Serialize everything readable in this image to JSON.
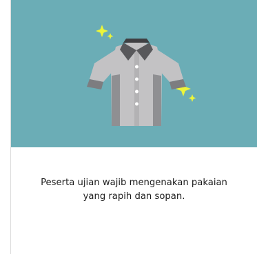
{
  "illustration": {
    "icon": "shirt-icon",
    "sparkles": [
      "sparkle-icon",
      "sparkle-icon"
    ],
    "background_color": "#6badb6",
    "shirt_color": "#c3c2c4",
    "collar_color": "#4f4f52",
    "sparkle_color": "#ecf53a"
  },
  "caption": {
    "text": "Peserta ujian wajib mengenakan pakaian\nyang rapih dan sopan."
  }
}
